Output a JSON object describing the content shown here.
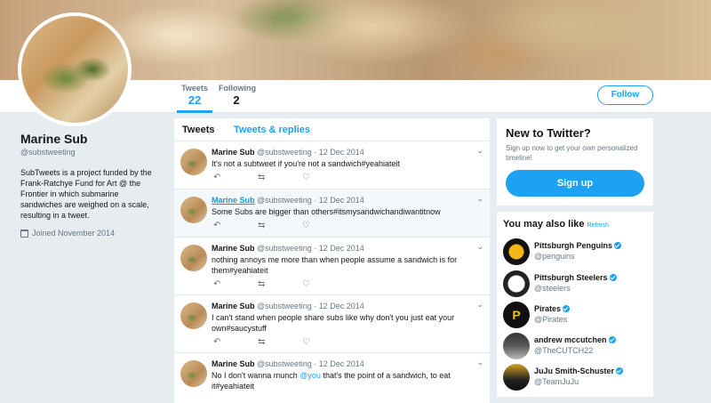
{
  "header": {
    "stats": [
      {
        "label": "Tweets",
        "value": "22"
      },
      {
        "label": "Following",
        "value": "2"
      }
    ],
    "follow_label": "Follow"
  },
  "profile": {
    "name": "Marine Sub",
    "handle": "@substweeting",
    "bio": "SubTweets is a project funded by the Frank-Ratchye Fund for Art @ the Frontier in which submarine sandwiches are weighed on a scale, resulting in a tweet.",
    "joined": "Joined November 2014"
  },
  "timeline": {
    "tabs": [
      "Tweets",
      "Tweets & replies"
    ],
    "tweets": [
      {
        "name": "Marine Sub",
        "handle": "@substweeting",
        "date": "12 Dec 2014",
        "text": "It's not a subtweet if you're not a sandwich#yeahiateit"
      },
      {
        "name": "Marine Sub",
        "handle": "@substweeting",
        "date": "12 Dec 2014",
        "text": "Some Subs are bigger than others#itsmysandwichandiwantitnow"
      },
      {
        "name": "Marine Sub",
        "handle": "@substweeting",
        "date": "12 Dec 2014",
        "text": "nothing annoys me more than when people assume a sandwich is for them#yeahiateit"
      },
      {
        "name": "Marine Sub",
        "handle": "@substweeting",
        "date": "12 Dec 2014",
        "text": "I can't stand when people  share subs like why don't you just eat your own#saucystuff"
      },
      {
        "name": "Marine Sub",
        "handle": "@substweeting",
        "date": "12 Dec 2014",
        "text_before": "No I don't wanna munch ",
        "mention": "@you",
        "text_after": " that's the point of a sandwich, to eat it#yeahiateit"
      }
    ]
  },
  "signup": {
    "title": "New to Twitter?",
    "desc": "Sign up now to get your own personalized timeline!",
    "button": "Sign up"
  },
  "suggestions": {
    "title": "You may also like",
    "refresh": "Refresh",
    "accounts": [
      {
        "name": "Pittsburgh Penguins",
        "handle": "@penguins"
      },
      {
        "name": "Pittsburgh Steelers",
        "handle": "@steelers"
      },
      {
        "name": "Pirates",
        "handle": "@Pirates",
        "pic_letter": "P"
      },
      {
        "name": "andrew mccutchen",
        "handle": "@TheCUTCH22"
      },
      {
        "name": "JuJu Smith-Schuster",
        "handle": "@TeamJuJu"
      }
    ]
  },
  "icons": {
    "reply": "reply-icon",
    "retweet": "retweet-icon",
    "like": "heart-icon",
    "more": "chevron-down-icon",
    "calendar": "calendar-icon",
    "verified": "verified-badge-icon"
  },
  "colors": {
    "accent": "#1da1f2",
    "background": "#e6ecf0",
    "muted": "#657786"
  }
}
